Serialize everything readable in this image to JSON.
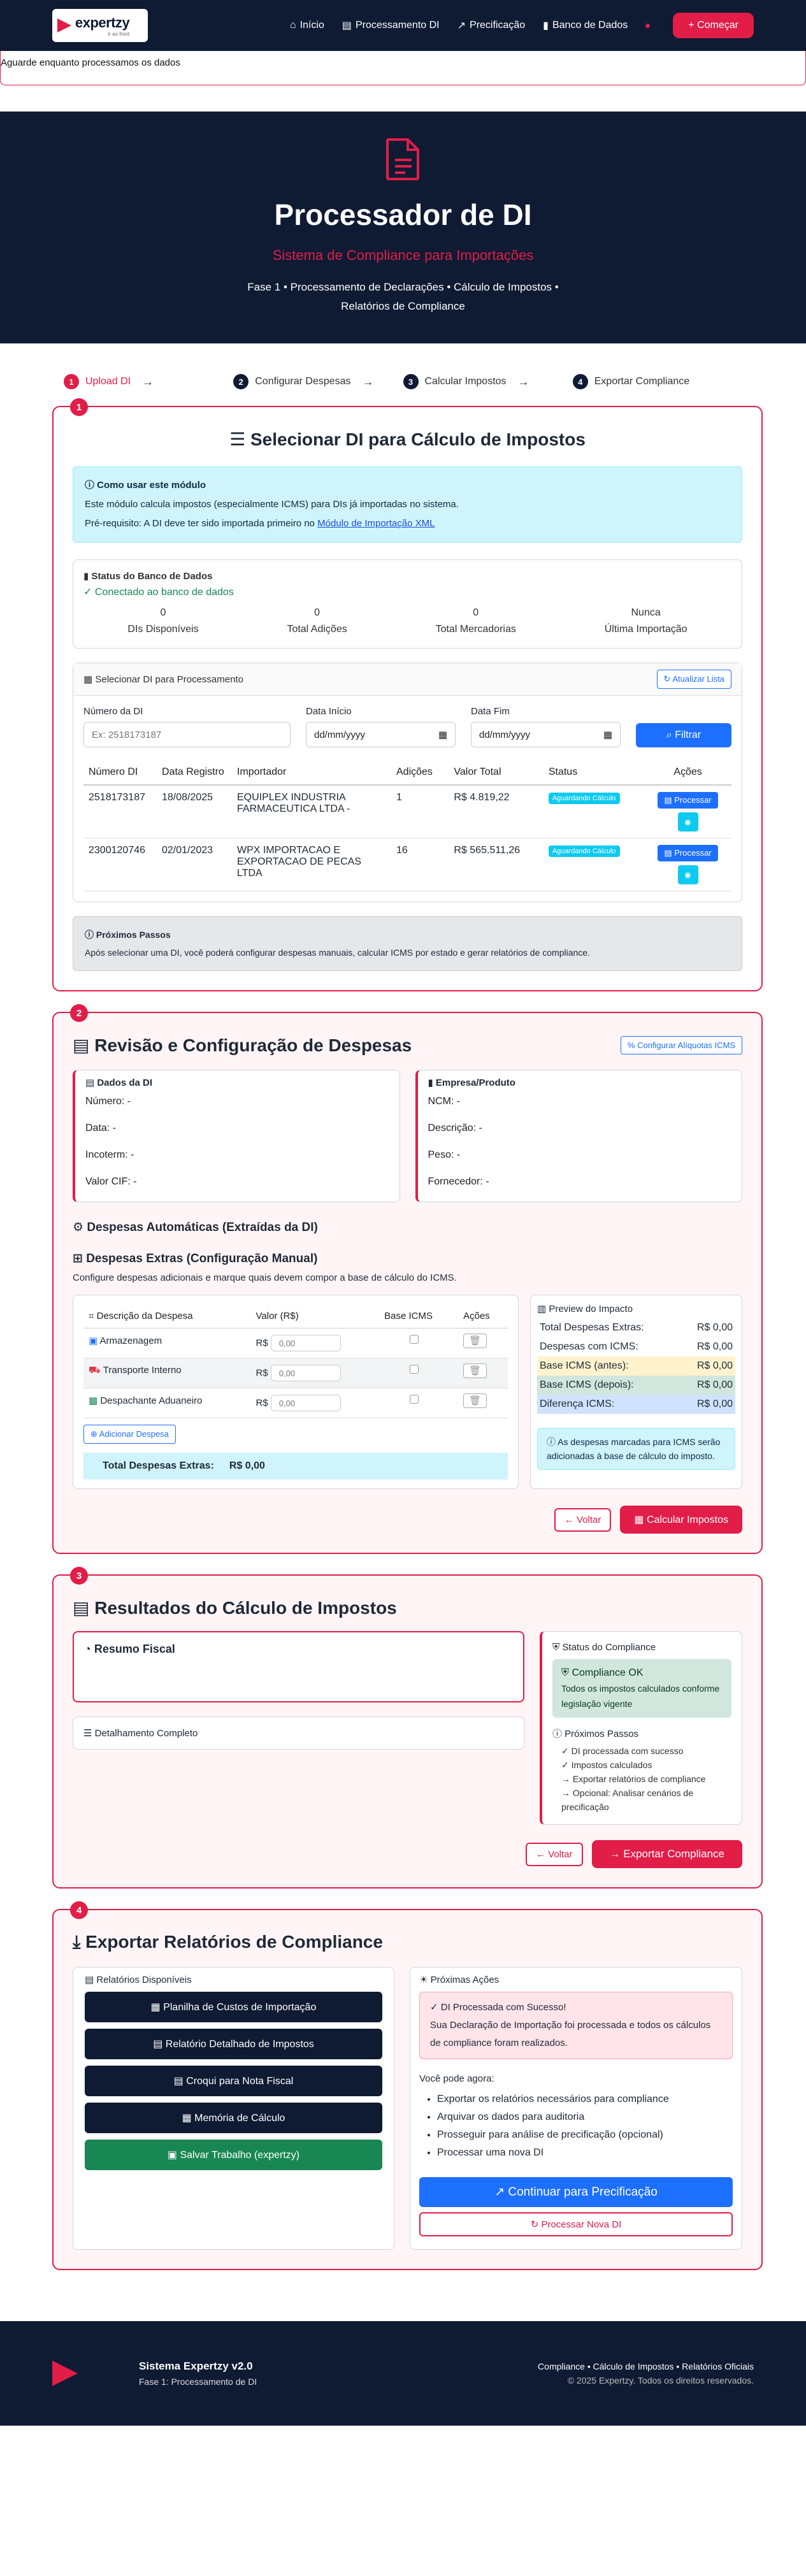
{
  "nav": {
    "logo": "expertzy",
    "logo_sub": "ir ao front",
    "links": [
      "Início",
      "Processamento DI",
      "Precificação",
      "Banco de Dados"
    ],
    "cta": "Começar"
  },
  "loading": "Aguarde enquanto processamos os dados",
  "hero": {
    "title": "Processador de DI",
    "subtitle": "Sistema de Compliance para Importações",
    "desc1": "Fase 1 • Processamento de Declarações • Cálculo de Impostos •",
    "desc2": "Relatórios de Compliance"
  },
  "steps": [
    {
      "n": "1",
      "label": "Upload DI"
    },
    {
      "n": "2",
      "label": "Configurar Despesas"
    },
    {
      "n": "3",
      "label": "Calcular Impostos"
    },
    {
      "n": "4",
      "label": "Exportar Compliance"
    }
  ],
  "s1": {
    "num": "1",
    "title": "Selecionar DI para Cálculo de Impostos",
    "howto_title": "Como usar este módulo",
    "howto_1": "Este módulo calcula impostos (especialmente ICMS) para DIs já importadas no sistema.",
    "howto_2": "Pré-requisito: A DI deve ter sido importada primeiro no ",
    "howto_link": "Módulo de Importação XML",
    "db_title": "Status do Banco de Dados",
    "db_ok": "Conectado ao banco de dados",
    "stats": [
      {
        "v": "0",
        "l": "DIs Disponíveis"
      },
      {
        "v": "0",
        "l": "Total Adições"
      },
      {
        "v": "0",
        "l": "Total Mercadorias"
      },
      {
        "v": "Nunca",
        "l": "Última Importação"
      }
    ],
    "select_title": "Selecionar DI para Processamento",
    "refresh": "Atualizar Lista",
    "f_num": "Número da DI",
    "f_num_ph": "Ex: 2518173187",
    "f_ini": "Data Início",
    "f_fim": "Data Fim",
    "date_ph": "dd/mm/yyyy",
    "filter": "Filtrar",
    "cols": [
      "Número DI",
      "Data Registro",
      "Importador",
      "Adições",
      "Valor Total",
      "Status",
      "Ações"
    ],
    "rows": [
      {
        "num": "2518173187",
        "data": "18/08/2025",
        "imp": "EQUIPLEX INDUSTRIA FARMACEUTICA LTDA -",
        "ad": "1",
        "val": "R$ 4.819,22",
        "st": "Aguardando Cálculo",
        "btn": "Processar"
      },
      {
        "num": "2300120746",
        "data": "02/01/2023",
        "imp": "WPX IMPORTACAO E EXPORTACAO DE PECAS LTDA",
        "ad": "16",
        "val": "R$ 565.511,26",
        "st": "Aguardando Cálculo",
        "btn": "Processar"
      }
    ],
    "next_title": "Próximos Passos",
    "next_text": "Após selecionar uma DI, você poderá configurar despesas manuais, calcular ICMS por estado e gerar relatórios de compliance."
  },
  "s2": {
    "num": "2",
    "title": "Revisão e Configuração de Despesas",
    "cfg_btn": "Configurar Alíquotas ICMS",
    "di_title": "Dados da DI",
    "di": [
      "Número: -",
      "Data: -",
      "Incoterm: -",
      "Valor CIF: -"
    ],
    "emp_title": "Empresa/Produto",
    "emp": [
      "NCM: -",
      "Descrição: -",
      "Peso: -",
      "Fornecedor: -"
    ],
    "auto": "Despesas Automáticas (Extraídas da DI)",
    "extra": "Despesas Extras (Configuração Manual)",
    "extra_desc": "Configure despesas adicionais e marque quais devem compor a base de cálculo do ICMS.",
    "cols": [
      "Descrição da Despesa",
      "Valor (R$)",
      "Base ICMS",
      "Ações"
    ],
    "items": [
      {
        "d": "Armazenagem",
        "c": "R$",
        "v": "0,00"
      },
      {
        "d": "Transporte Interno",
        "c": "R$",
        "v": "0,00"
      },
      {
        "d": "Despachante Aduaneiro",
        "c": "R$",
        "v": "0,00"
      }
    ],
    "add": "Adicionar Despesa",
    "total_l": "Total Despesas Extras:",
    "total_v": "R$ 0,00",
    "prev_title": "Preview do Impacto",
    "prev": [
      {
        "l": "Total Despesas Extras:",
        "v": "R$ 0,00",
        "c": ""
      },
      {
        "l": "Despesas com ICMS:",
        "v": "R$ 0,00",
        "c": ""
      },
      {
        "l": "Base ICMS (antes):",
        "v": "R$ 0,00",
        "c": "#fff3cd"
      },
      {
        "l": "Base ICMS (depois):",
        "v": "R$ 0,00",
        "c": "#d1e7dd"
      },
      {
        "l": "Diferença ICMS:",
        "v": "R$ 0,00",
        "c": "#cfe2ff"
      }
    ],
    "prev_note": "As despesas marcadas para ICMS serão adicionadas à base de cálculo do imposto.",
    "back": "Voltar",
    "calc": "Calcular Impostos"
  },
  "s3": {
    "num": "3",
    "title": "Resultados do Cálculo de Impostos",
    "resumo": "Resumo Fiscal",
    "detalhe": "Detalhamento Completo",
    "status_title": "Status do Compliance",
    "ok_title": "Compliance OK",
    "ok_text": "Todos os impostos calculados conforme legislação vigente",
    "next": "Próximos Passos",
    "list": [
      "✓ DI processada com sucesso",
      "✓ Impostos calculados",
      "→ Exportar relatórios de compliance",
      "→ Opcional: Analisar cenários de precificação"
    ],
    "back": "Voltar",
    "export": "Exportar Compliance"
  },
  "s4": {
    "num": "4",
    "title": "Exportar Relatórios de Compliance",
    "avail": "Relatórios Disponíveis",
    "btns": [
      "Planilha de Custos de Importação",
      "Relatório Detalhado de Impostos",
      "Croqui para Nota Fiscal",
      "Memória de Cálculo",
      "Salvar Trabalho (expertzy)"
    ],
    "next": "Próximas Ações",
    "ok_title": "DI Processada com Sucesso!",
    "ok_text": "Sua Declaração de Importação foi processada e todos os cálculos de compliance foram realizados.",
    "can": "Você pode agora:",
    "list": [
      "Exportar os relatórios necessários para compliance",
      "Arquivar os dados para auditoria",
      "Prosseguir para análise de precificação (opcional)",
      "Processar uma nova DI"
    ],
    "cont": "Continuar para Precificação",
    "new": "Processar Nova DI"
  },
  "footer": {
    "name": "Sistema Expertzy v2.0",
    "phase": "Fase 1: Processamento de DI",
    "right": "Compliance • Cálculo de Impostos • Relatórios Oficiais",
    "copy": "© 2025 Expertzy. Todos os direitos reservados."
  },
  "colors": {
    "navy": "#0f1a33",
    "red": "#e11d48",
    "blue": "#1d6fff",
    "cyan": "#0dcaf0"
  }
}
